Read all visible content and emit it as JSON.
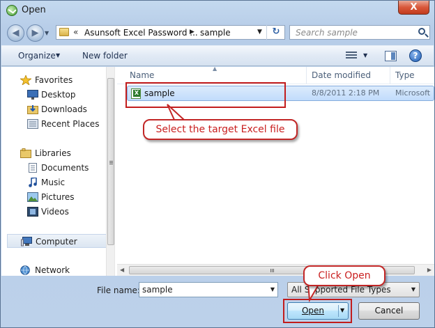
{
  "window": {
    "title": "Open",
    "close_glyph": "X"
  },
  "nav": {
    "back_glyph": "◀",
    "forward_glyph": "▶",
    "recent_glyph": "▼"
  },
  "address": {
    "overflow": "«",
    "segment1": "Asunsoft Excel Password ...",
    "separator": "▶",
    "segment2": "sample",
    "dropdown_glyph": "▼",
    "refresh_glyph": "↻"
  },
  "search": {
    "placeholder": "Search sample"
  },
  "toolbar": {
    "organize_label": "Organize",
    "organize_arrow": "▼",
    "new_folder_label": "New folder",
    "views_arrow": "▼",
    "help_glyph": "?"
  },
  "sidebar": {
    "items": [
      {
        "label": "Favorites",
        "icon": "star-icon"
      },
      {
        "label": "Desktop",
        "icon": "desktop-icon"
      },
      {
        "label": "Downloads",
        "icon": "downloads-icon"
      },
      {
        "label": "Recent Places",
        "icon": "recent-places-icon"
      },
      {
        "label": "Libraries",
        "icon": "libraries-icon"
      },
      {
        "label": "Documents",
        "icon": "documents-icon"
      },
      {
        "label": "Music",
        "icon": "music-icon"
      },
      {
        "label": "Pictures",
        "icon": "pictures-icon"
      },
      {
        "label": "Videos",
        "icon": "videos-icon"
      },
      {
        "label": "Computer",
        "icon": "computer-icon"
      },
      {
        "label": "Network",
        "icon": "network-icon"
      }
    ]
  },
  "columns": {
    "name": "Name",
    "date_modified": "Date modified",
    "type": "Type"
  },
  "files": [
    {
      "name": "sample",
      "date_modified": "8/8/2011 2:18 PM",
      "type": "Microsoft",
      "icon": "excel-file-icon"
    }
  ],
  "bottom": {
    "file_name_label": "File name:",
    "file_name_value": "sample",
    "filter_value": "All Supported File Types",
    "open_label": "Open",
    "cancel_label": "Cancel",
    "dropdown_glyph": "▼"
  },
  "scroll": {
    "left_glyph": "◀",
    "right_glyph": "▶"
  },
  "annotations": {
    "select_file": "Select the target Excel file",
    "click_open": "Click Open",
    "color": "#c21c1c"
  }
}
